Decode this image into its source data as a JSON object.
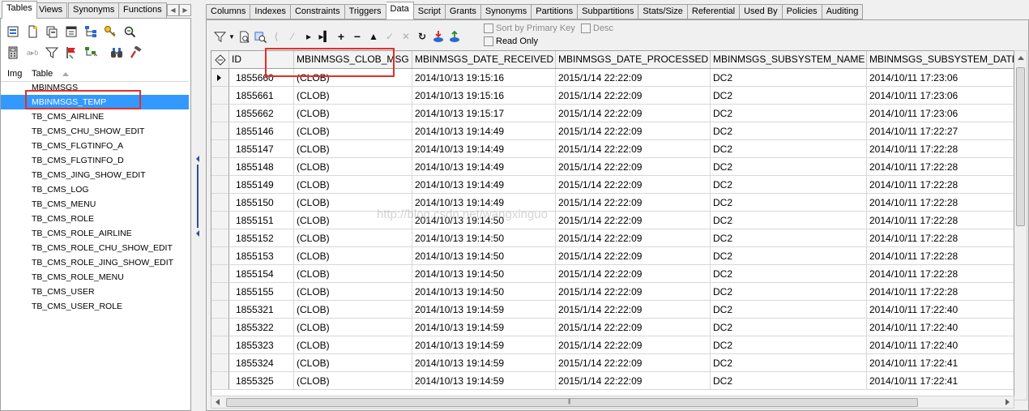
{
  "left_tabs": [
    "Tables",
    "Views",
    "Synonyms",
    "Functions"
  ],
  "left_header": {
    "img": "Img",
    "table": "Table"
  },
  "tables": [
    "MBINMSGS",
    "MBINMSGS_TEMP",
    "TB_CMS_AIRLINE",
    "TB_CMS_CHU_SHOW_EDIT",
    "TB_CMS_FLGTINFO_A",
    "TB_CMS_FLGTINFO_D",
    "TB_CMS_JING_SHOW_EDIT",
    "TB_CMS_LOG",
    "TB_CMS_MENU",
    "TB_CMS_ROLE",
    "TB_CMS_ROLE_AIRLINE",
    "TB_CMS_ROLE_CHU_SHOW_EDIT",
    "TB_CMS_ROLE_JING_SHOW_EDIT",
    "TB_CMS_ROLE_MENU",
    "TB_CMS_USER",
    "TB_CMS_USER_ROLE"
  ],
  "selected_table": "MBINMSGS_TEMP",
  "right_tabs": [
    "Columns",
    "Indexes",
    "Constraints",
    "Triggers",
    "Data",
    "Script",
    "Grants",
    "Synonyms",
    "Partitions",
    "Subpartitions",
    "Stats/Size",
    "Referential",
    "Used By",
    "Policies",
    "Auditing"
  ],
  "active_right_tab": "Data",
  "options": {
    "sort_by_pk": "Sort by Primary Key",
    "desc": "Desc",
    "read_only": "Read Only"
  },
  "grid": {
    "columns": [
      "ID",
      "MBINMSGS_CLOB_MSG",
      "MBINMSGS_DATE_RECEIVED",
      "MBINMSGS_DATE_PROCESSED",
      "MBINMSGS_SUBSYSTEM_NAME",
      "MBINMSGS_SUBSYSTEM_DATE_SE"
    ],
    "rows": [
      [
        "1855660",
        "(CLOB)",
        "2014/10/13 19:15:16",
        "2015/1/14 22:22:09",
        "DC2",
        "2014/10/11 17:23:06"
      ],
      [
        "1855661",
        "(CLOB)",
        "2014/10/13 19:15:16",
        "2015/1/14 22:22:09",
        "DC2",
        "2014/10/11 17:23:06"
      ],
      [
        "1855662",
        "(CLOB)",
        "2014/10/13 19:15:17",
        "2015/1/14 22:22:09",
        "DC2",
        "2014/10/11 17:23:06"
      ],
      [
        "1855146",
        "(CLOB)",
        "2014/10/13 19:14:49",
        "2015/1/14 22:22:09",
        "DC2",
        "2014/10/11 17:22:27"
      ],
      [
        "1855147",
        "(CLOB)",
        "2014/10/13 19:14:49",
        "2015/1/14 22:22:09",
        "DC2",
        "2014/10/11 17:22:28"
      ],
      [
        "1855148",
        "(CLOB)",
        "2014/10/13 19:14:49",
        "2015/1/14 22:22:09",
        "DC2",
        "2014/10/11 17:22:28"
      ],
      [
        "1855149",
        "(CLOB)",
        "2014/10/13 19:14:49",
        "2015/1/14 22:22:09",
        "DC2",
        "2014/10/11 17:22:28"
      ],
      [
        "1855150",
        "(CLOB)",
        "2014/10/13 19:14:49",
        "2015/1/14 22:22:09",
        "DC2",
        "2014/10/11 17:22:28"
      ],
      [
        "1855151",
        "(CLOB)",
        "2014/10/13 19:14:50",
        "2015/1/14 22:22:09",
        "DC2",
        "2014/10/11 17:22:28"
      ],
      [
        "1855152",
        "(CLOB)",
        "2014/10/13 19:14:50",
        "2015/1/14 22:22:09",
        "DC2",
        "2014/10/11 17:22:28"
      ],
      [
        "1855153",
        "(CLOB)",
        "2014/10/13 19:14:50",
        "2015/1/14 22:22:09",
        "DC2",
        "2014/10/11 17:22:28"
      ],
      [
        "1855154",
        "(CLOB)",
        "2014/10/13 19:14:50",
        "2015/1/14 22:22:09",
        "DC2",
        "2014/10/11 17:22:28"
      ],
      [
        "1855155",
        "(CLOB)",
        "2014/10/13 19:14:50",
        "2015/1/14 22:22:09",
        "DC2",
        "2014/10/11 17:22:28"
      ],
      [
        "1855321",
        "(CLOB)",
        "2014/10/13 19:14:59",
        "2015/1/14 22:22:09",
        "DC2",
        "2014/10/11 17:22:40"
      ],
      [
        "1855322",
        "(CLOB)",
        "2014/10/13 19:14:59",
        "2015/1/14 22:22:09",
        "DC2",
        "2014/10/11 17:22:40"
      ],
      [
        "1855323",
        "(CLOB)",
        "2014/10/13 19:14:59",
        "2015/1/14 22:22:09",
        "DC2",
        "2014/10/11 17:22:40"
      ],
      [
        "1855324",
        "(CLOB)",
        "2014/10/13 19:14:59",
        "2015/1/14 22:22:09",
        "DC2",
        "2014/10/11 17:22:41"
      ],
      [
        "1855325",
        "(CLOB)",
        "2014/10/13 19:14:59",
        "2015/1/14 22:22:09",
        "DC2",
        "2014/10/11 17:22:41"
      ]
    ]
  },
  "watermark": "http://blog.csdn.net/wangxinguo",
  "colors": {
    "selection": "#3399ff",
    "highlight_box": "#e0302a"
  }
}
